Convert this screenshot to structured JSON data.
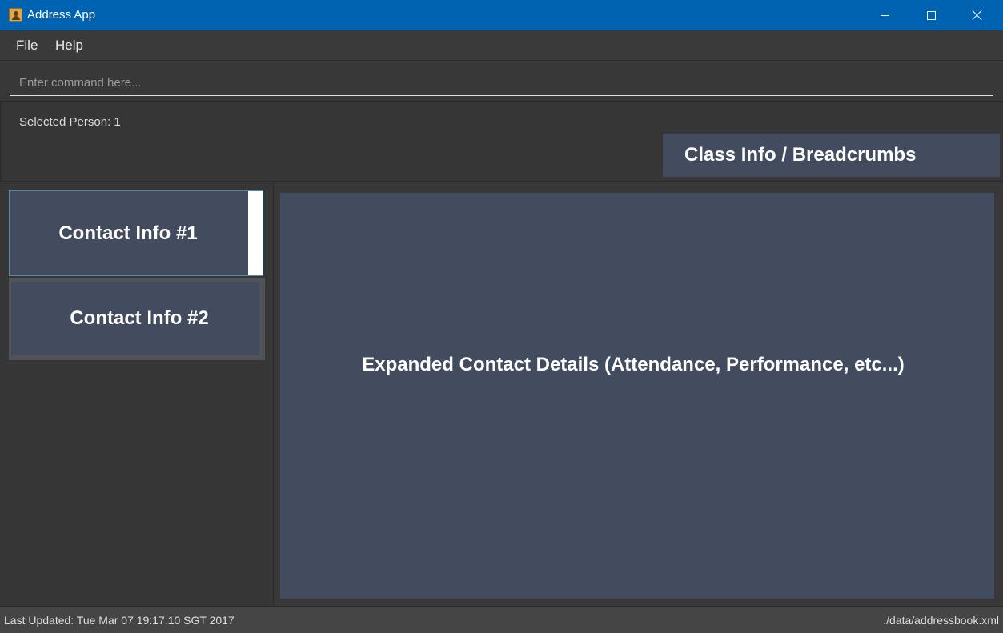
{
  "window": {
    "title": "Address App"
  },
  "menu": {
    "file_label": "File",
    "help_label": "Help"
  },
  "command": {
    "placeholder": "Enter command here...",
    "value": ""
  },
  "result": {
    "text": "Selected Person: 1",
    "breadcrumb": "Class Info / Breadcrumbs"
  },
  "contacts": [
    {
      "label": "Contact Info #1",
      "selected": true
    },
    {
      "label": "Contact Info #2",
      "selected": false
    }
  ],
  "details": {
    "text": "Expanded Contact Details (Attendance, Performance, etc...)"
  },
  "status": {
    "last_updated": "Last Updated: Tue Mar 07 19:17:10 SGT 2017",
    "file_path": "./data/addressbook.xml"
  },
  "colors": {
    "titlebar": "#0063b1",
    "panel": "#434c5e",
    "background": "#383838"
  }
}
